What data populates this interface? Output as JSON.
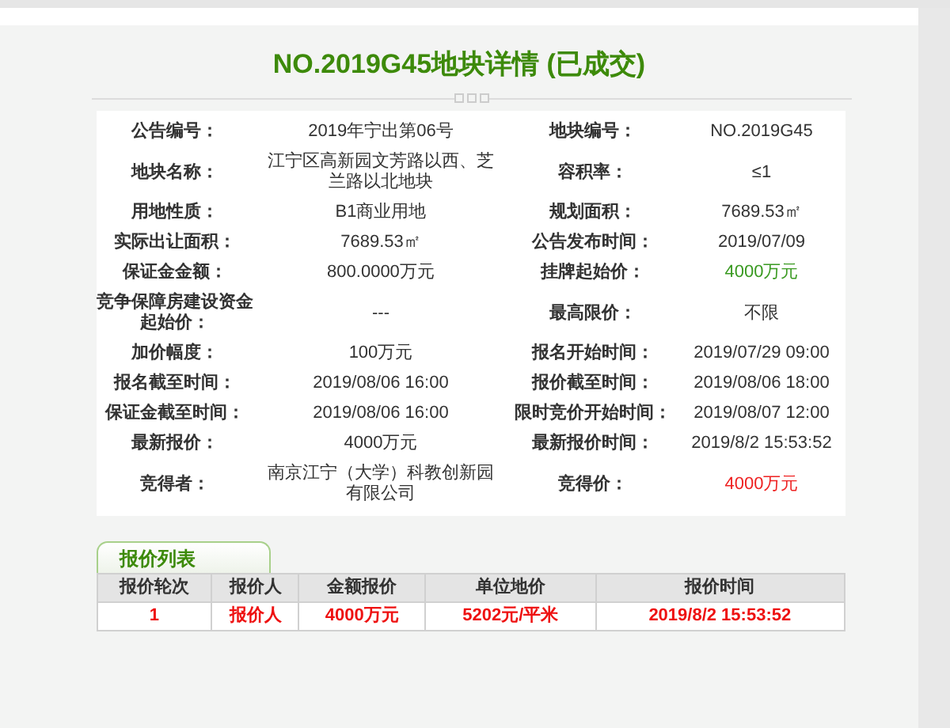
{
  "title": "NO.2019G45地块详情 (已成交)",
  "details": [
    {
      "label": "公告编号：",
      "value": "2019年宁出第06号"
    },
    {
      "label": "地块编号：",
      "value": "NO.2019G45"
    },
    {
      "label": "地块名称：",
      "value": "江宁区高新园文芳路以西、芝兰路以北地块"
    },
    {
      "label": "容积率：",
      "value": "≤1"
    },
    {
      "label": "用地性质：",
      "value": "B1商业用地"
    },
    {
      "label": "规划面积：",
      "value": "7689.53㎡"
    },
    {
      "label": "实际出让面积：",
      "value": "7689.53㎡"
    },
    {
      "label": "公告发布时间：",
      "value": "2019/07/09"
    },
    {
      "label": "保证金金额：",
      "value": "800.0000万元"
    },
    {
      "label": "挂牌起始价：",
      "value": "4000万元",
      "color": "#3a9a22"
    },
    {
      "label": "竞争保障房建设资金起始价：",
      "value": "---"
    },
    {
      "label": "最高限价：",
      "value": "不限"
    },
    {
      "label": "加价幅度：",
      "value": "100万元"
    },
    {
      "label": "报名开始时间：",
      "value": "2019/07/29 09:00"
    },
    {
      "label": "报名截至时间：",
      "value": "2019/08/06 16:00"
    },
    {
      "label": "报价截至时间：",
      "value": "2019/08/06 18:00"
    },
    {
      "label": "保证金截至时间：",
      "value": "2019/08/06 16:00"
    },
    {
      "label": "限时竞价开始时间：",
      "value": "2019/08/07 12:00"
    },
    {
      "label": "最新报价：",
      "value": "4000万元"
    },
    {
      "label": "最新报价时间：",
      "value": "2019/8/2 15:53:52"
    },
    {
      "label": "竞得者：",
      "value": "南京江宁（大学）科教创新园有限公司"
    },
    {
      "label": "竞得价：",
      "value": "4000万元",
      "color": "#ee2222"
    }
  ],
  "bids_tab": {
    "label": "报价列表",
    "selected": true
  },
  "bids_table": {
    "columns": [
      "报价轮次",
      "报价人",
      "金额报价",
      "单位地价",
      "报价时间"
    ],
    "rows": [
      [
        "1",
        "报价人",
        "4000万元",
        "5202元/平米",
        "2019/8/2 15:53:52"
      ]
    ]
  }
}
